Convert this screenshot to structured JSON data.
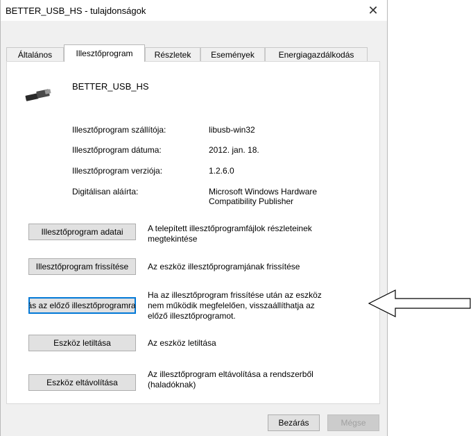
{
  "window": {
    "title": "BETTER_USB_HS - tulajdonságok",
    "close_glyph": "✕"
  },
  "tabs": [
    {
      "label": "Általános"
    },
    {
      "label": "Illesztőprogram",
      "active": true
    },
    {
      "label": "Részletek"
    },
    {
      "label": "Események"
    },
    {
      "label": "Energiagazdálkodás"
    }
  ],
  "device": {
    "name": "BETTER_USB_HS",
    "icon": "usb-plug-icon"
  },
  "info": [
    {
      "label": "Illesztőprogram szállítója:",
      "value": "libusb-win32"
    },
    {
      "label": "Illesztőprogram dátuma:",
      "value": "2012. jan. 18."
    },
    {
      "label": "Illesztőprogram verziója:",
      "value": "1.2.6.0"
    },
    {
      "label": "Digitálisan aláírta:",
      "value_line1": "Microsoft Windows Hardware",
      "value_line2": "Compatibility Publisher"
    }
  ],
  "actions": [
    {
      "button": "Illesztőprogram adatai",
      "desc_line1": "A telepített illesztőprogramfájlok részleteinek",
      "desc_line2": "megtekintése"
    },
    {
      "button": "Illesztőprogram frissítése",
      "desc_line1": "Az eszköz illesztőprogramjának frissítése"
    },
    {
      "button": "Visszaállás az előző illesztőprogramra",
      "desc_line1": "Ha az illesztőprogram frissítése után az eszköz",
      "desc_line2": "nem működik megfelelően, visszaállíthatja az",
      "desc_line3": "előző illesztőprogramot."
    },
    {
      "button": "Eszköz letiltása",
      "desc_line1": "Az eszköz letiltása"
    },
    {
      "button": "Eszköz eltávolítása",
      "desc_line1": "Az illesztőprogram eltávolítása a rendszerből",
      "desc_line2": "(haladóknak)"
    }
  ],
  "footer": {
    "close": "Bezárás",
    "cancel": "Mégse"
  },
  "colors": {
    "focus": "#0078d7",
    "panel": "#ffffff",
    "dialog": "#f0f0f0"
  }
}
